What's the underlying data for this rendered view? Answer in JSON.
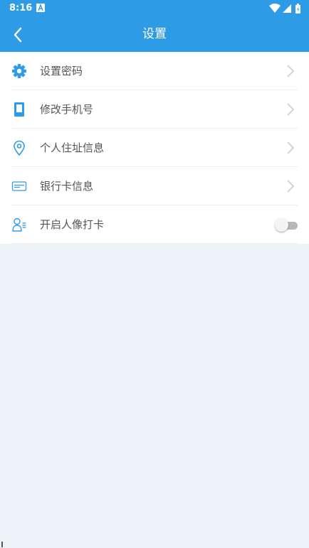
{
  "status_bar": {
    "time": "8:16"
  },
  "app_bar": {
    "title": "设置",
    "back_icon": "chevron-left-icon"
  },
  "settings": {
    "items": [
      {
        "label": "设置密码",
        "icon": "gear-icon",
        "control": "chevron"
      },
      {
        "label": "修改手机号",
        "icon": "phone-icon",
        "control": "chevron"
      },
      {
        "label": "个人住址信息",
        "icon": "location-pin-icon",
        "control": "chevron"
      },
      {
        "label": "银行卡信息",
        "icon": "bank-card-icon",
        "control": "chevron"
      },
      {
        "label": "开启人像打卡",
        "icon": "face-id-icon",
        "control": "toggle",
        "enabled": false
      }
    ]
  },
  "colors": {
    "primary": "#2e9be6",
    "background": "#edf2f7",
    "row_background": "#ffffff",
    "label_text": "#555555",
    "divider": "#e9eef2",
    "chevron": "#c8c8c8"
  }
}
